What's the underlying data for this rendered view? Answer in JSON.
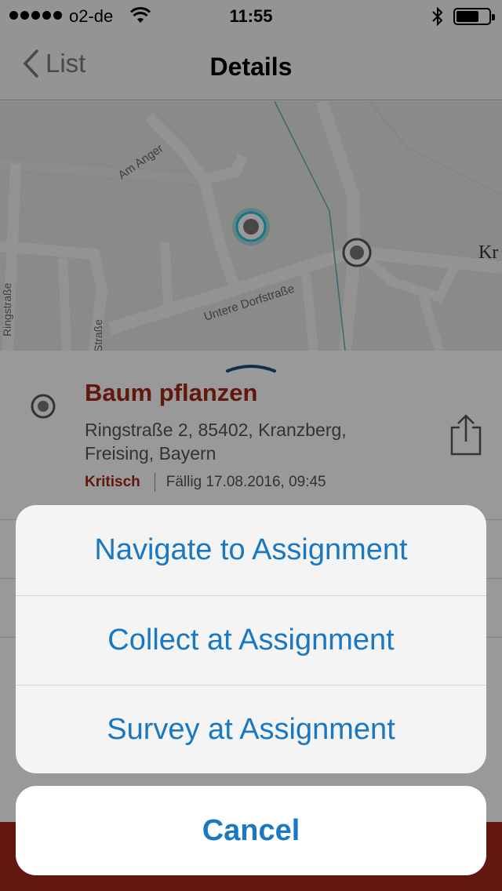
{
  "status_bar": {
    "carrier": "o2-de",
    "time": "11:55"
  },
  "nav": {
    "back_label": "List",
    "title": "Details"
  },
  "map": {
    "labels": [
      "Am Anger",
      "Untere Dorfstraße",
      "Kr",
      "Ringstraße",
      "Straße"
    ]
  },
  "task": {
    "title": "Baum pflanzen",
    "address": "Ringstraße 2, 85402, Kranzberg, Freising, Bayern",
    "priority": "Kritisch",
    "due": "Fällig 17.08.2016, 09:45"
  },
  "action_sheet": {
    "navigate_label": "Navigate to Assignment",
    "collect_label": "Collect at Assignment",
    "survey_label": "Survey at Assignment",
    "cancel_label": "Cancel"
  },
  "colors": {
    "accent": "#1a78c2",
    "brand": "#a3271a",
    "location_glow": "#22c7d6"
  },
  "icons": [
    "wifi-icon",
    "bluetooth-icon",
    "battery-icon",
    "chevron-left-icon",
    "target-icon",
    "share-icon",
    "map-marker-icon"
  ]
}
